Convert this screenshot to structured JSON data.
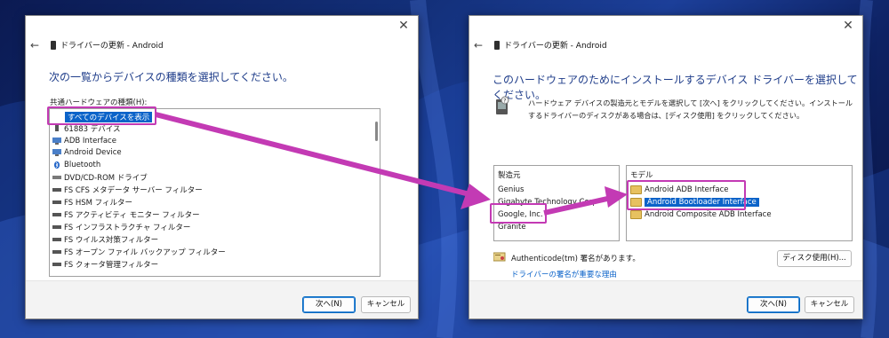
{
  "dialog1": {
    "title": "ドライバーの更新 - Android",
    "instruction": "次の一覧からデバイスの種類を選択してください。",
    "list_label": "共通ハードウェアの種類(H):",
    "items": [
      {
        "label": "すべてのデバイスを表示",
        "icon": "device-list-icon",
        "selected": true
      },
      {
        "label": "61883 デバイス",
        "icon": "plug-icon"
      },
      {
        "label": "ADB Interface",
        "icon": "monitor-icon"
      },
      {
        "label": "Android Device",
        "icon": "monitor-icon"
      },
      {
        "label": "Bluetooth",
        "icon": "bluetooth-icon"
      },
      {
        "label": "DVD/CD-ROM ドライブ",
        "icon": "drive-icon"
      },
      {
        "label": "FS CFS メタデータ サーバー フィルター",
        "icon": "drive-icon"
      },
      {
        "label": "FS HSM フィルター",
        "icon": "drive-icon"
      },
      {
        "label": "FS アクティビティ モニター フィルター",
        "icon": "drive-icon"
      },
      {
        "label": "FS インフラストラクチャ フィルター",
        "icon": "drive-icon"
      },
      {
        "label": "FS ウイルス対策フィルター",
        "icon": "drive-icon"
      },
      {
        "label": "FS オープン ファイル バックアップ フィルター",
        "icon": "drive-icon"
      },
      {
        "label": "FS クォータ管理フィルター",
        "icon": "drive-icon"
      }
    ],
    "next_label": "次へ(N)",
    "cancel_label": "キャンセル"
  },
  "dialog2": {
    "title": "ドライバーの更新 - Android",
    "instruction": "このハードウェアのためにインストールするデバイス ドライバーを選択してください。",
    "description": "ハードウェア デバイスの製造元とモデルを選択して [次へ] をクリックしてください。インストールするドライバーのディスクがある場合は、[ディスク使用] をクリックしてください。",
    "manufacturer_header": "製造元",
    "manufacturers": [
      "Genius",
      "Gigabyte Technology Corp",
      "Google, Inc.",
      "Granite"
    ],
    "selected_manufacturer": "Google, Inc.",
    "model_header": "モデル",
    "models": [
      {
        "label": "Android ADB Interface",
        "selected": false
      },
      {
        "label": "Android Bootloader Interface",
        "selected": true
      },
      {
        "label": "Android Composite ADB Interface",
        "selected": false
      }
    ],
    "signed_text": "Authenticode(tm) 署名があります。",
    "link_text": "ドライバーの署名が重要な理由",
    "disk_button": "ディスク使用(H)...",
    "next_label": "次へ(N)",
    "cancel_label": "キャンセル"
  },
  "colors": {
    "highlight": "#c33ab4",
    "selection": "#0b63c9",
    "instruction_text": "#1f3d8a"
  }
}
